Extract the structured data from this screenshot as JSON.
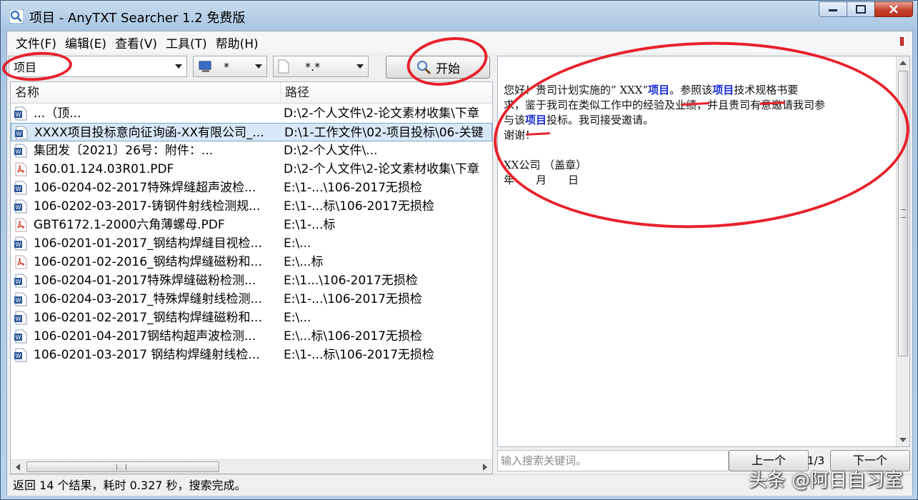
{
  "window": {
    "title": "项目 - AnyTXT Searcher 1.2 免费版",
    "icon": "magnifier-app-icon"
  },
  "menu": [
    "文件(F)",
    "编辑(E)",
    "查看(V)",
    "工具(T)",
    "帮助(H)"
  ],
  "toolbar": {
    "search_value": "项目",
    "drive_value": "*",
    "filetype_value": "*.*",
    "start_label": "开始"
  },
  "list": {
    "columns": [
      "名称",
      "路径"
    ],
    "rows": [
      {
        "icon": "word-doc-icon",
        "name": "...（顶...",
        "path": "D:\\2-个人文件\\2-论文素材收集\\下章",
        "selected": false
      },
      {
        "icon": "word-doc-icon",
        "name": "XXXX项目投标意向征询函-XX有限公司_...",
        "path": "D:\\1-工作文件\\02-项目投标\\06-关键",
        "selected": true
      },
      {
        "icon": "word-doc-icon",
        "name": "集团发〔2021〕26号：附件：...",
        "path": "D:\\2-个人文件\\...",
        "selected": false
      },
      {
        "icon": "pdf-icon",
        "name": "160.01.124.03R01.PDF",
        "path": "D:\\2-个人文件\\2-论文素材收集\\下章",
        "selected": false
      },
      {
        "icon": "word-doc-icon",
        "name": "106-0204-02-2017特殊焊缝超声波检...",
        "path": "E:\\1-...\\106-2017无损检",
        "selected": false
      },
      {
        "icon": "word-doc-icon",
        "name": "106-0202-03-2017-铸钢件射线检测规...",
        "path": "E:\\1-...标\\106-2017无损检",
        "selected": false
      },
      {
        "icon": "pdf-icon",
        "name": "GBT6172.1-2000六角薄螺母.PDF",
        "path": "E:\\1-...标",
        "selected": false
      },
      {
        "icon": "word-doc-icon",
        "name": "106-0201-01-2017_钢结构焊缝目视检...",
        "path": "E:\\...",
        "selected": false
      },
      {
        "icon": "pdf-icon",
        "name": "106-0201-02-2016_钢结构焊缝磁粉和...",
        "path": "E:\\...标",
        "selected": false
      },
      {
        "icon": "word-doc-icon",
        "name": "106-0204-01-2017特殊焊缝磁粉检测...",
        "path": "E:\\1...\\106-2017无损检",
        "selected": false
      },
      {
        "icon": "word-doc-icon",
        "name": "106-0204-03-2017_特殊焊缝射线检测...",
        "path": "E:\\1-...\\106-2017无损检",
        "selected": false
      },
      {
        "icon": "word-doc-icon",
        "name": "106-0201-02-2017_钢结构焊缝磁粉和...",
        "path": "E:\\...",
        "selected": false
      },
      {
        "icon": "word-doc-icon",
        "name": "106-0201-04-2017钢结构超声波检测...",
        "path": "E:\\...标\\106-2017无损检",
        "selected": false
      },
      {
        "icon": "word-doc-icon",
        "name": "106-0201-03-2017 钢结构焊缝射线检...",
        "path": "E:\\1-...标\\106-2017无损检",
        "selected": false
      }
    ]
  },
  "preview": {
    "line1_a": "您好！贵司计划实施的” XXX”",
    "kw1": "项目",
    "line1_b": "。参照该",
    "kw2": "项目",
    "line1_c": "技术规格书要",
    "line2": "求，鉴于我司在类似工作中的经验及业绩，并且贵司有意邀请我司参",
    "line3_a": "与该",
    "kw3": "项目",
    "line3_b": "投标。我司接受邀请。",
    "line4": "谢谢！",
    "line5": "XX公司 （盖章）",
    "line6": "年　　月　　日"
  },
  "keyword_input_placeholder": "输入搜索关键词。",
  "nav": {
    "prev": "上一个",
    "page": "1/3",
    "next": "下一个"
  },
  "status": "返回 14 个结果，耗时 0.327 秒，搜索完成。",
  "watermark": "头条 @阿日自习室",
  "colors": {
    "highlight": "#1a2bd6",
    "annotation": "#e8212b",
    "selection": "#d9e8f8"
  }
}
